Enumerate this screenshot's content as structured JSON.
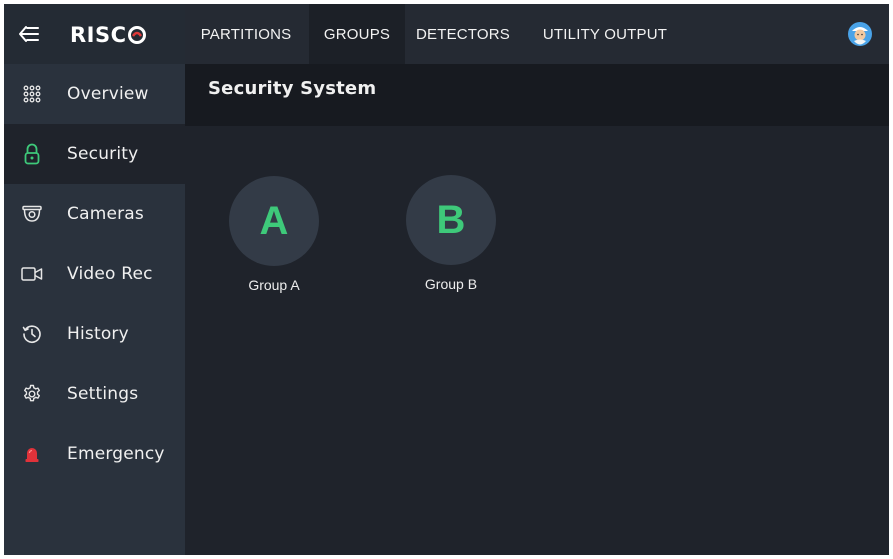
{
  "app": {
    "logo_text": "RISC",
    "brand_color": "#ffffff",
    "accent": "#3ec97a"
  },
  "sidebar": {
    "back_icon": "back-arrow-icon",
    "items": [
      {
        "label": "Overview",
        "icon": "grid-dots-icon",
        "active": false
      },
      {
        "label": "Security",
        "icon": "lock-icon",
        "active": true
      },
      {
        "label": "Cameras",
        "icon": "camera-icon",
        "active": false
      },
      {
        "label": "Video Rec",
        "icon": "video-camera-icon",
        "active": false
      },
      {
        "label": "History",
        "icon": "history-clock-icon",
        "active": false
      },
      {
        "label": "Settings",
        "icon": "gear-icon",
        "active": false
      },
      {
        "label": "Emergency",
        "icon": "emergency-siren-icon",
        "active": false
      }
    ]
  },
  "topbar": {
    "tabs": [
      {
        "label": "PARTITIONS",
        "active": false
      },
      {
        "label": "GROUPS",
        "active": true
      },
      {
        "label": "DETECTORS",
        "active": false
      },
      {
        "label": "UTILITY OUTPUT",
        "active": false
      }
    ],
    "avatar_icon": "user-avatar-icon"
  },
  "main": {
    "title": "Security System",
    "groups": [
      {
        "letter": "A",
        "label": "Group A"
      },
      {
        "letter": "B",
        "label": "Group B"
      }
    ]
  }
}
